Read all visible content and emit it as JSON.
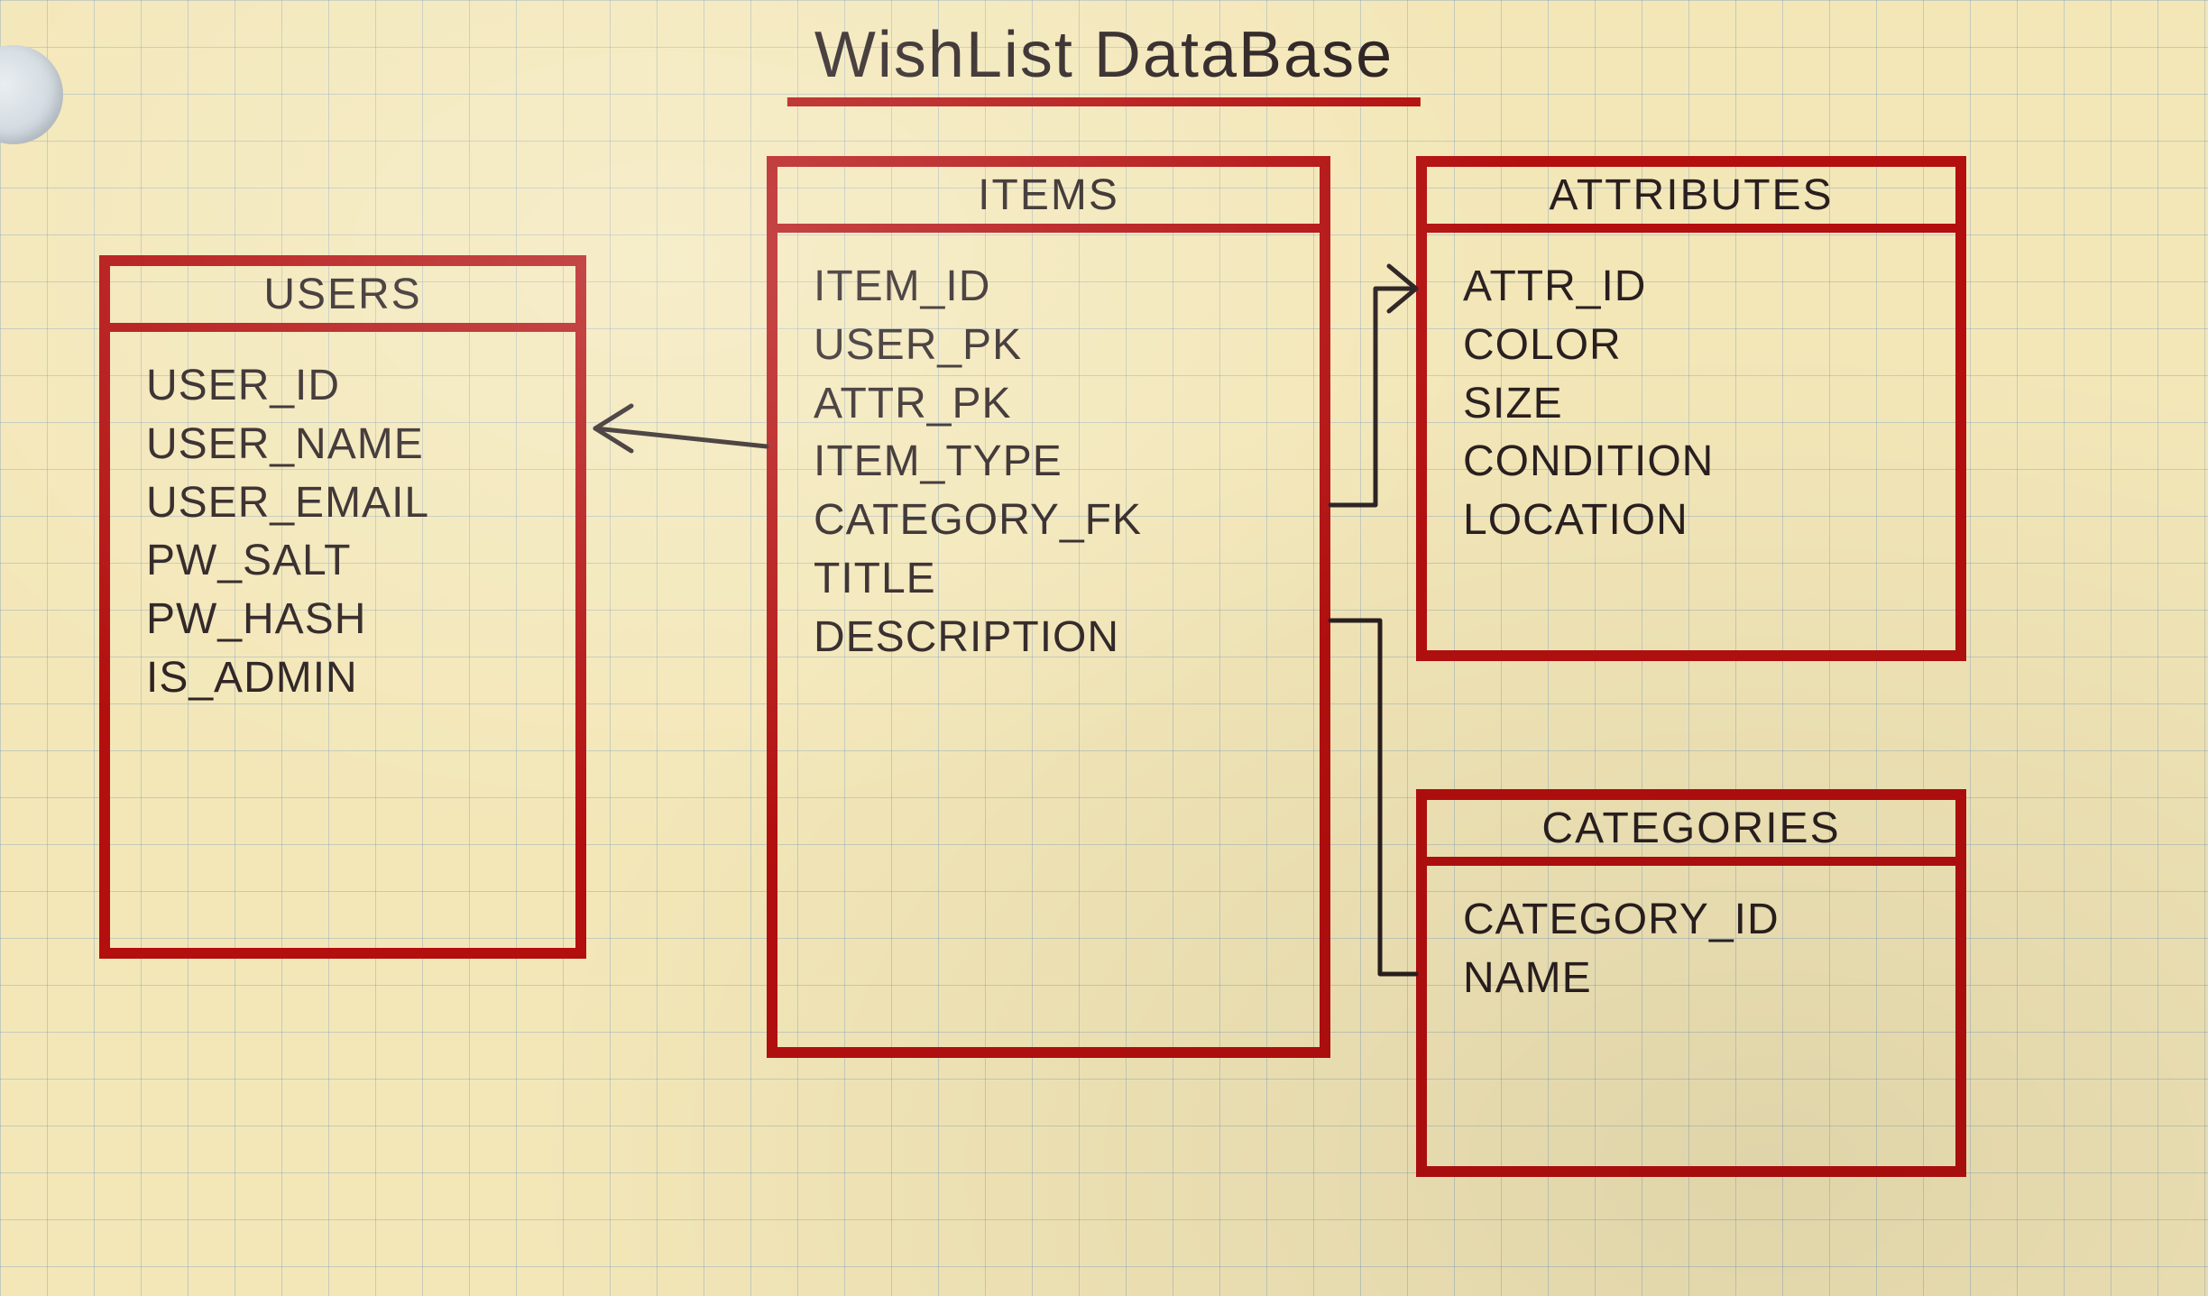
{
  "title": "WishList  DataBase",
  "entities": {
    "users": {
      "name": "USERS",
      "fields": [
        "USER_ID",
        "USER_NAME",
        "USER_EMAIL",
        "PW_SALT",
        "PW_HASH",
        "IS_ADMIN"
      ]
    },
    "items": {
      "name": "ITEMS",
      "fields": [
        "ITEM_ID",
        "USER_PK",
        "ATTR_PK",
        "ITEM_TYPE",
        "CATEGORY_FK",
        "TITLE",
        "DESCRIPTION"
      ]
    },
    "attributes": {
      "name": "ATTRIBUTES",
      "fields": [
        "ATTR_ID",
        "COLOR",
        "SIZE",
        "CONDITION",
        "LOCATION"
      ]
    },
    "categories": {
      "name": "CATEGORIES",
      "fields": [
        "CATEGORY_ID",
        "NAME"
      ]
    }
  },
  "relations": [
    {
      "from_entity": "items",
      "from_field": "USER_PK",
      "to_entity": "users",
      "to_field": "USER_ID"
    },
    {
      "from_entity": "items",
      "from_field": "ATTR_PK",
      "to_entity": "attributes",
      "to_field": "ATTR_ID"
    },
    {
      "from_entity": "items",
      "from_field": "CATEGORY_FK",
      "to_entity": "categories",
      "to_field": "CATEGORY_ID"
    }
  ],
  "colors": {
    "ink": "#2a1f1f",
    "marker": "#b30f0f",
    "paper": "#f3e7b8"
  }
}
